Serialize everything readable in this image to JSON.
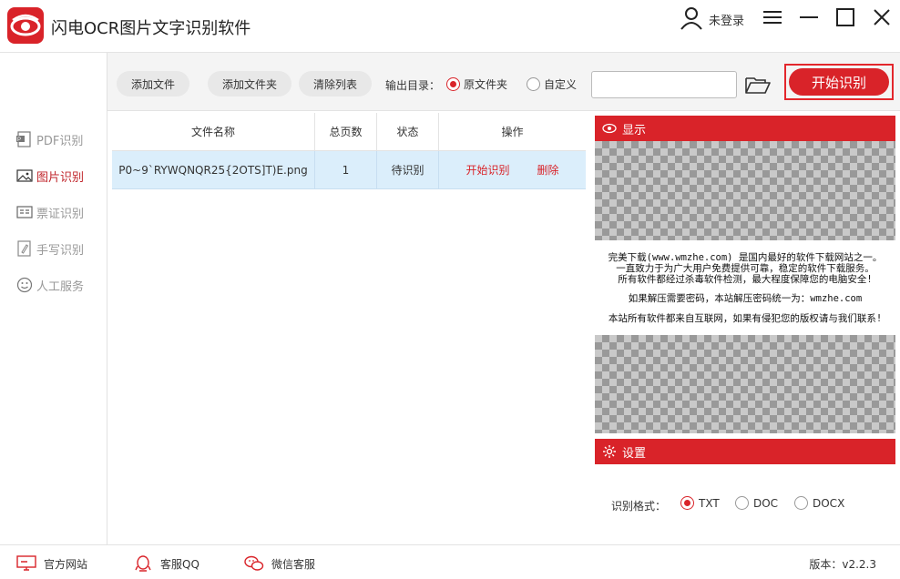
{
  "app": {
    "title": "闪电OCR图片文字识别软件"
  },
  "header": {
    "login_label": "未登录"
  },
  "sidebar": {
    "items": [
      {
        "label": "PDF识别",
        "active": false
      },
      {
        "label": "图片识别",
        "active": true
      },
      {
        "label": "票证识别",
        "active": false
      },
      {
        "label": "手写识别",
        "active": false
      },
      {
        "label": "人工服务",
        "active": false
      }
    ]
  },
  "toolbar": {
    "add_file": "添加文件",
    "add_folder": "添加文件夹",
    "clear_list": "清除列表",
    "output_label": "输出目录：",
    "output_options": [
      "原文件夹",
      "自定义"
    ],
    "output_selected": "原文件夹",
    "path_value": "",
    "start_button": "开始识别"
  },
  "table": {
    "headers": [
      "文件名称",
      "总页数",
      "状态",
      "操作"
    ],
    "rows": [
      {
        "filename": "P0~9`RYWQNQR25{2OTS]T)E.png",
        "pages": "1",
        "status": "待识别",
        "action_start": "开始识别",
        "action_delete": "删除"
      }
    ]
  },
  "display_panel": {
    "title": "显示",
    "notice_lines": [
      "完美下载(www.wmzhe.com) 是国内最好的软件下载网站之一。",
      "一直致力于为广大用户免费提供可靠，稳定的软件下载服务。",
      "所有软件都经过杀毒软件检测，最大程度保障您的电脑安全!",
      "如果解压需要密码，本站解压密码统一为：wmzhe.com",
      "本站所有软件都来自互联网，如果有侵犯您的版权请与我们联系!"
    ]
  },
  "settings_panel": {
    "title": "设置",
    "format_label": "识别格式：",
    "formats": [
      "TXT",
      "DOC",
      "DOCX"
    ],
    "format_selected": "TXT"
  },
  "footer": {
    "website": "官方网站",
    "qq": "客服QQ",
    "wechat": "微信客服",
    "version": "版本：v2.2.3"
  },
  "colors": {
    "accent": "#d92329",
    "row_highlight": "#dbeefb"
  },
  "icons": [
    "app-logo-eye-icon",
    "user-icon",
    "menu-icon",
    "minimize-icon",
    "maximize-icon",
    "close-icon",
    "pdf-icon",
    "image-icon",
    "ticket-icon",
    "handwriting-icon",
    "smile-icon",
    "folder-open-icon",
    "eye-icon",
    "gear-icon",
    "monitor-icon",
    "qq-icon",
    "wechat-icon"
  ]
}
